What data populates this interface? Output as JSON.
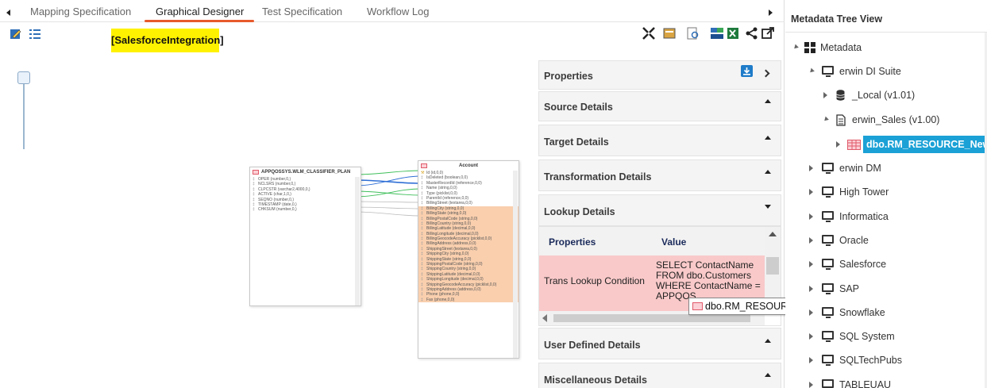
{
  "tabs": {
    "items": [
      "Mapping Specification",
      "Graphical Designer",
      "Test Specification",
      "Workflow Log"
    ],
    "active": "Graphical Designer"
  },
  "canvas": {
    "title": "[SalesforceIntegration]",
    "source_table": {
      "name": "APPQOSSYS.WLM_CLASSIFIER_PLAN",
      "columns": [
        "OPER (number,0,)",
        "NCLSRS (number,0,)",
        "CLPCSTR (varchar2,4000,0,)",
        "ACTIVE (char,1,0,)",
        "SEQNO (number,0,)",
        "TIMESTAMP (date,0,)",
        "CHKSUM (number,0,)"
      ]
    },
    "target_table": {
      "name": "Account",
      "columns": [
        "Id (id,0,0)",
        "IsDeleted (boolean,0,0)",
        "MasterRecordId (reference,0,0)",
        "Name (string,0,0)",
        "Type (picklist,0,0)",
        "ParentId (reference,0,0)",
        "BillingStreet (textarea,0,0)",
        "BillingCity (string,0,0)",
        "BillingState (string,0,0)",
        "BillingPostalCode (string,0,0)",
        "BillingCountry (string,0,0)",
        "BillingLatitude (decimal,0,0)",
        "BillingLongitude (decimal,0,0)",
        "BillingGeocodeAccuracy (picklist,0,0)",
        "BillingAddress (address,0,0)",
        "ShippingStreet (textarea,0,0)",
        "ShippingCity (string,0,0)",
        "ShippingState (string,0,0)",
        "ShippingPostalCode (string,0,0)",
        "ShippingCountry (string,0,0)",
        "ShippingLatitude (decimal,0,0)",
        "ShippingLongitude (decimal,0,0)",
        "ShippingGeocodeAccuracy (picklist,0,0)",
        "ShippingAddress (address,0,0)",
        "Phone (phone,0,0)",
        "Fax (phone,0,0)"
      ],
      "highlight_from_index": 7
    }
  },
  "properties": {
    "title": "Properties",
    "sections": [
      "Source Details",
      "Target Details",
      "Transformation Details",
      "Lookup Details",
      "User Defined Details",
      "Miscellaneous Details"
    ],
    "grid": {
      "col_property": "Properties",
      "col_value": "Value",
      "row_property": "Trans Lookup Condition",
      "row_value": "SELECT ContactName FROM dbo.Customers WHERE ContactName = APPQOS"
    },
    "tooltip": "dbo.RM_RESOURCE_New"
  },
  "tree": {
    "title": "Metadata Tree View",
    "root": "Metadata",
    "erwin_di_suite": "erwin DI Suite",
    "local": "_Local (v1.01)",
    "erwin_sales": "erwin_Sales (v1.00)",
    "selected": "dbo.RM_RESOURCE_New",
    "systems": [
      "erwin DM",
      "High Tower",
      "Informatica",
      "Oracle",
      "Salesforce",
      "SAP",
      "Snowflake",
      "SQL System",
      "SQLTechPubs",
      "TABLEUAU"
    ]
  },
  "colors": {
    "accent_tab": "#e85a2c",
    "title_badge": "#fff200",
    "selected_node": "#1ba1d6",
    "highlight_row": "#f9cfae",
    "lookup_row": "#f9c9c9"
  }
}
